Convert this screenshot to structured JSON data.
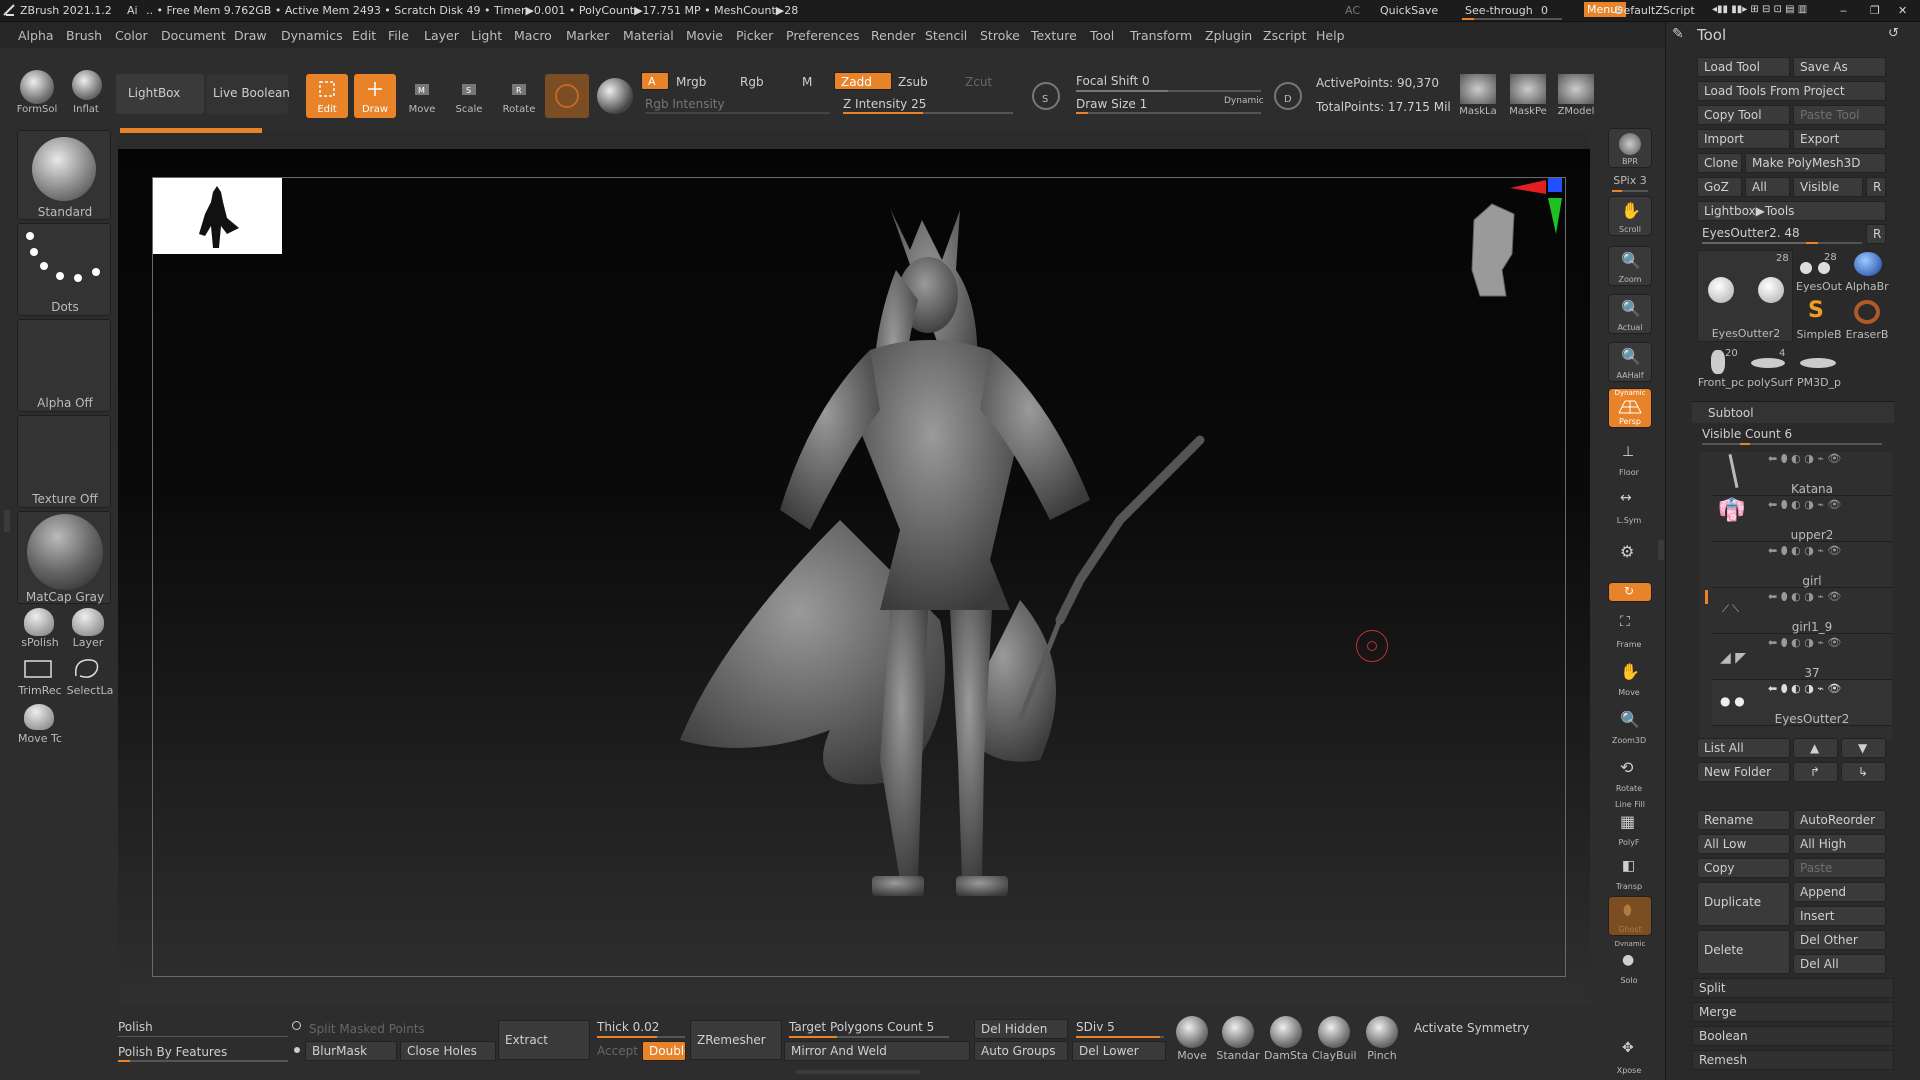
{
  "titlebar": {
    "app": "ZBrush 2021.1.2",
    "ai": "Ai",
    "stats": ".. • Free Mem 9.762GB • Active Mem 2493 • Scratch Disk 49 • Timer▶0.001 • PolyCount▶17.751 MP • MeshCount▶28",
    "ac": "AC",
    "quicksave": "QuickSave",
    "seethrough": "See-through",
    "seethrough_value": "0",
    "menus": "Menus",
    "script": "DefaultZScript"
  },
  "menu": [
    "Alpha",
    "Brush",
    "Color",
    "Document",
    "Draw",
    "Dynamics",
    "Edit",
    "File",
    "Layer",
    "Light",
    "Macro",
    "Marker",
    "Material",
    "Movie",
    "Picker",
    "Preferences",
    "Render",
    "Stencil",
    "Stroke",
    "Texture",
    "Tool",
    "Transform",
    "Zplugin",
    "Zscript",
    "Help"
  ],
  "top": {
    "formsol": "FormSol",
    "inflat": "Inflat",
    "lightbox": "LightBox",
    "liveboolean": "Live Boolean",
    "edit": "Edit",
    "draw": "Draw",
    "move": "Move",
    "scale": "Scale",
    "rotate": "Rotate",
    "a": "A",
    "mrgb": "Mrgb",
    "rgb": "Rgb",
    "m": "M",
    "rgb_intensity": "Rgb Intensity",
    "zadd": "Zadd",
    "zsub": "Zsub",
    "zcut": "Zcut",
    "zintensity": "Z Intensity 25",
    "focal": "Focal Shift 0",
    "drawsize": "Draw Size 1",
    "dynamic": "Dynamic",
    "activepoints": "ActivePoints: 90,370",
    "totalpoints": "TotalPoints: 17.715 Mil",
    "maskla": "MaskLa",
    "maskpe": "MaskPe",
    "zmodel": "ZModel",
    "icon_s": "S",
    "icon_d": "D"
  },
  "left": {
    "standard": "Standard",
    "dots": "Dots",
    "alpha": "Alpha Off",
    "texture": "Texture Off",
    "matcap": "MatCap Gray",
    "spolish": "sPolish",
    "layer": "Layer",
    "trimrec": "TrimRec",
    "selectla": "SelectLa",
    "movetc": "Move Tc"
  },
  "right": [
    "BPR",
    "SPix 3",
    "Scroll",
    "Zoom",
    "Actual",
    "AAHalf",
    "Persp",
    "Floor",
    "L.Sym",
    "",
    "",
    "Frame",
    "Move",
    "Zoom3D",
    "Rotate",
    "PolyF",
    "Transp",
    "Ghost",
    "Solo",
    "Xpose"
  ],
  "right_extra": {
    "dynamic": "Dynamic",
    "linefill": "Line Fill"
  },
  "bottom": {
    "polish": "Polish",
    "polishfeat": "Polish By Features",
    "splitmasked": "Split Masked Points",
    "blurmask": "BlurMask",
    "closeholes": "Close Holes",
    "extract": "Extract",
    "thick": "Thick 0.02",
    "accept": "Accept",
    "double": "Double",
    "zremesher": "ZRemesher",
    "target": "Target Polygons Count 5",
    "mirror": "Mirror And Weld",
    "delhidden": "Del Hidden",
    "autogroups": "Auto Groups",
    "sdiv": "SDiv 5",
    "dellower": "Del Lower",
    "brushes": [
      "Move",
      "Standar",
      "DamSta",
      "ClayBuil",
      "Pinch"
    ],
    "symmetry": "Activate Symmetry"
  },
  "tool": {
    "title": "Tool",
    "loadtool": "Load Tool",
    "saveas": "Save As",
    "loadfromproject": "Load Tools From Project",
    "copytool": "Copy Tool",
    "pastetool": "Paste Tool",
    "import": "Import",
    "export": "Export",
    "clone": "Clone",
    "makepoly": "Make PolyMesh3D",
    "goz": "GoZ",
    "all": "All",
    "visible": "Visible",
    "r": "R",
    "lightboxtools": "Lightbox▶Tools",
    "current": "EyesOutter2. 48",
    "thumbs": [
      {
        "label": "EyesOutter2",
        "num": "28"
      },
      {
        "label": "EyesOut",
        "num": "28"
      },
      {
        "label": "AlphaBr",
        "num": ""
      },
      {
        "label": "SimpleB",
        "num": ""
      },
      {
        "label": "EraserB",
        "num": ""
      },
      {
        "label": "Front_pc",
        "num": "20"
      },
      {
        "label": "polySurf",
        "num": "4"
      },
      {
        "label": "PM3D_p",
        "num": ""
      }
    ]
  },
  "subtool": {
    "title": "Subtool",
    "visiblecount": "Visible Count 6",
    "items": [
      "Katana",
      "upper2",
      "girl",
      "girl1_9",
      "37",
      "EyesOutter2"
    ],
    "listall": "List All",
    "newfolder": "New Folder",
    "rename": "Rename",
    "autoreorder": "AutoReorder",
    "alllow": "All Low",
    "allhigh": "All High",
    "copy": "Copy",
    "paste": "Paste",
    "duplicate": "Duplicate",
    "append": "Append",
    "insert": "Insert",
    "delete": "Delete",
    "delother": "Del Other",
    "delall": "Del All",
    "split": "Split",
    "merge": "Merge",
    "boolean": "Boolean",
    "remesh": "Remesh"
  },
  "colors": {
    "accent": "#e8832a",
    "panel": "#2d2d2d",
    "button": "#3a3a3a"
  }
}
